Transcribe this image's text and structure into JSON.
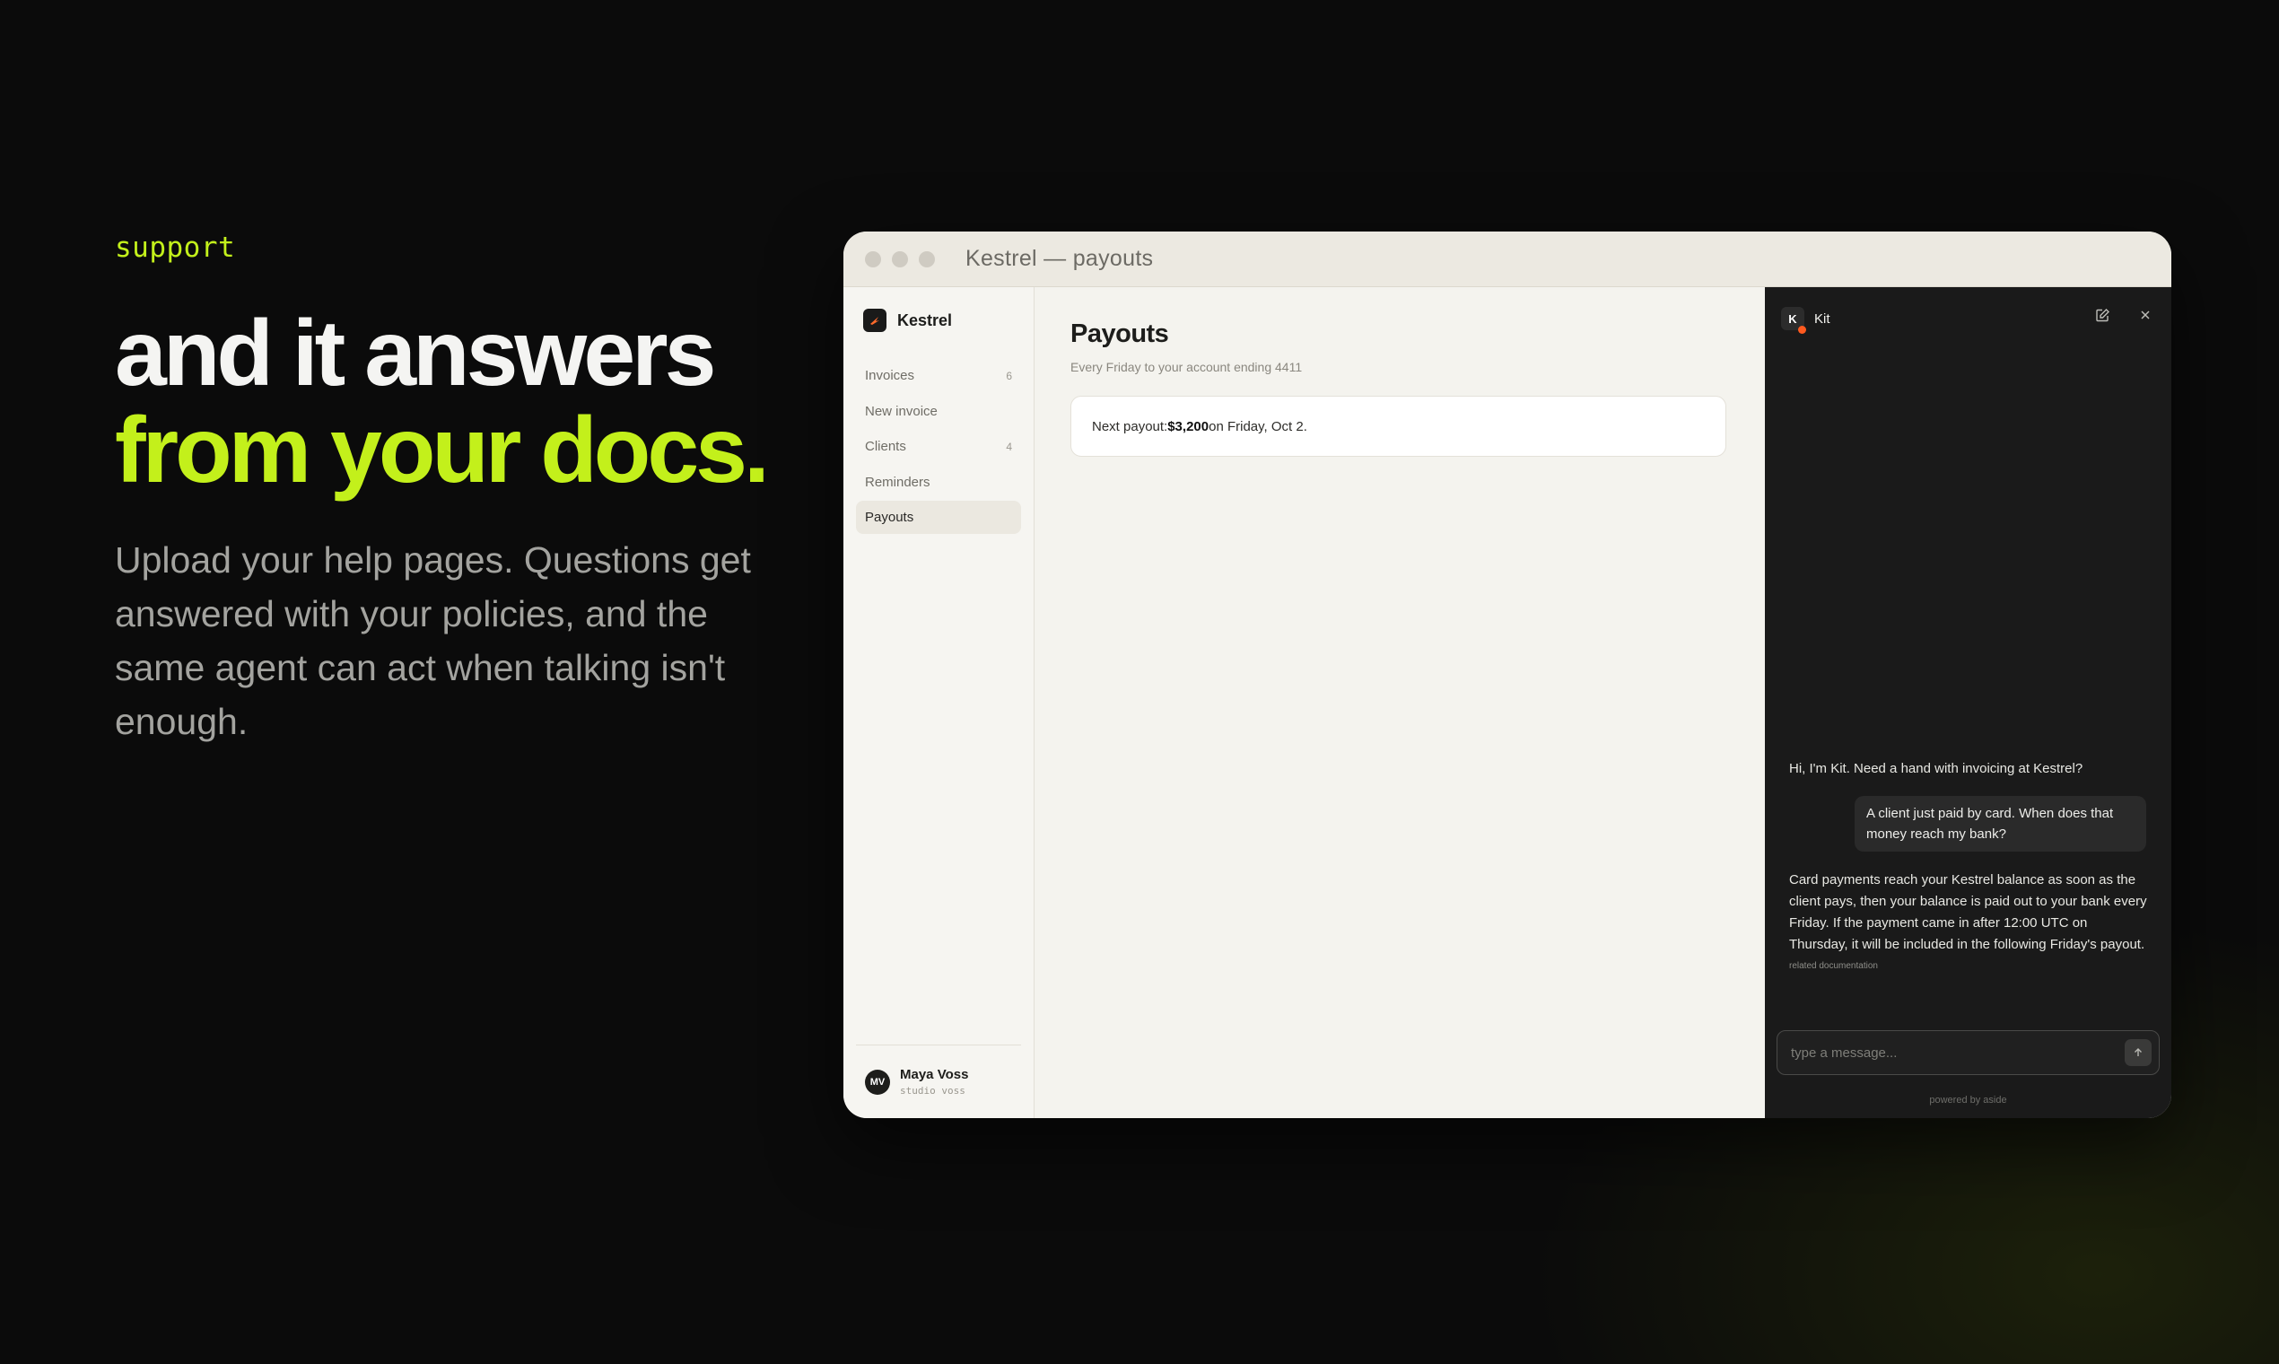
{
  "hero": {
    "eyebrow": "support",
    "headline_line1": "and it answers",
    "headline_line2": "from your docs.",
    "description": "Upload your help pages. Questions get answered with your policies, and the same agent can act when talking isn't enough."
  },
  "window": {
    "title": "Kestrel — payouts"
  },
  "sidebar": {
    "brand": "Kestrel",
    "items": [
      {
        "label": "Invoices",
        "count": "6"
      },
      {
        "label": "New invoice",
        "count": ""
      },
      {
        "label": "Clients",
        "count": "4"
      },
      {
        "label": "Reminders",
        "count": ""
      },
      {
        "label": "Payouts",
        "count": ""
      }
    ],
    "active_item": "Payouts",
    "user": {
      "initials": "MV",
      "name": "Maya Voss",
      "studio": "studio voss"
    }
  },
  "main": {
    "title": "Payouts",
    "subtitle": "Every Friday to your account ending 4411",
    "next_payout_prefix": "Next payout: ",
    "next_payout_amount": "$3,200",
    "next_payout_suffix": " on Friday, Oct 2."
  },
  "chat": {
    "agent_initial": "K",
    "agent_name": "Kit",
    "messages": [
      {
        "role": "assistant",
        "text": "Hi, I'm Kit. Need a hand with invoicing at Kestrel?"
      },
      {
        "role": "user",
        "text": "A client just paid by card. When does that money reach my bank?"
      },
      {
        "role": "assistant",
        "text": "Card payments reach your Kestrel balance as soon as the client pays, then your balance is paid out to your bank every Friday. If the payment came in after 12:00 UTC on Thursday, it will be included in the following Friday's payout."
      }
    ],
    "related_label": "related documentation",
    "input_placeholder": "type a message...",
    "powered_by": "powered by aside"
  },
  "colors": {
    "accent": "#c3f01b",
    "background": "#0b0b0b",
    "status_dot": "#ff5a1f"
  },
  "icons": {
    "brand": "kestrel-logo-icon",
    "compose": "edit-icon",
    "close": "close-icon",
    "send": "arrow-up-icon"
  }
}
